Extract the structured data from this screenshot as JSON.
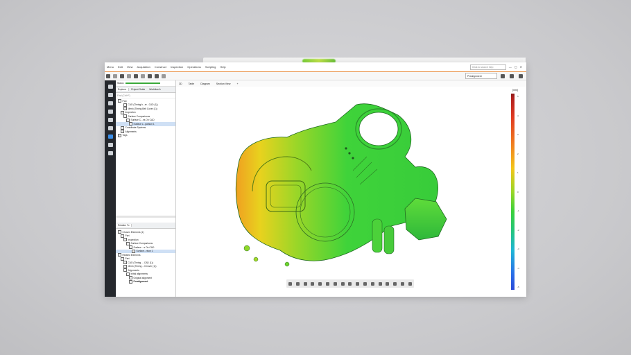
{
  "menu": [
    "Menu",
    "Edit",
    "View",
    "Acquisition",
    "Construct",
    "Inspection",
    "Operations",
    "Scripting",
    "Help"
  ],
  "search_placeholder": "Click to search help",
  "prealign_label": "Prealignment",
  "status_label": "Status",
  "panel_tabs": [
    "Explorer",
    "Project Guide",
    "Workflow A"
  ],
  "filter_placeholder": "Find (Ctrl+F)",
  "tree": [
    {
      "label": "Part",
      "indent": 0
    },
    {
      "label": "CAD (Timing b...er - CAD (1))",
      "indent": 2
    },
    {
      "label": "Mesh (Timing Belt Cover (1))",
      "indent": 2
    },
    {
      "label": "Inspection",
      "indent": 1
    },
    {
      "label": "Surface Comparisons",
      "indent": 2
    },
    {
      "label": "Surface C...ns On CAD",
      "indent": 3
    },
    {
      "label": "Surface c...parison 1",
      "indent": 4,
      "selected": true
    },
    {
      "label": "Coordinate Systems",
      "indent": 1
    },
    {
      "label": "Alignments",
      "indent": 1
    },
    {
      "label": "Tags",
      "indent": 0
    }
  ],
  "relation_tab": "Relation To",
  "tree2": [
    {
      "label": "Chosen Elements (1)",
      "indent": 0
    },
    {
      "label": "Part",
      "indent": 1
    },
    {
      "label": "Inspection",
      "indent": 2
    },
    {
      "label": "Surface Comparisons",
      "indent": 3
    },
    {
      "label": "Surface ...s On CAD",
      "indent": 4
    },
    {
      "label": "Surface...rison 1",
      "indent": 5,
      "selected": true
    },
    {
      "label": "Related Elements",
      "indent": 0
    },
    {
      "label": "Part",
      "indent": 1
    },
    {
      "label": "CAD (Timing ... CAD (1))",
      "indent": 2
    },
    {
      "label": "Mesh (Timing ...lt Cover (1))",
      "indent": 2
    },
    {
      "label": "Alignments",
      "indent": 2
    },
    {
      "label": "Initial alignments",
      "indent": 3
    },
    {
      "label": "Original alignment",
      "indent": 4
    },
    {
      "label": "Prealignment",
      "indent": 4,
      "bold": true
    }
  ],
  "view_tabs": [
    "3D",
    "Table",
    "Diagram",
    "Section View",
    "+"
  ],
  "colorbar_unit": "[mm]",
  "colorbar_ticks": [
    "5",
    "4",
    "3",
    "2",
    "1",
    "0",
    "-1",
    "-2",
    "-3",
    "-4",
    "-5"
  ]
}
